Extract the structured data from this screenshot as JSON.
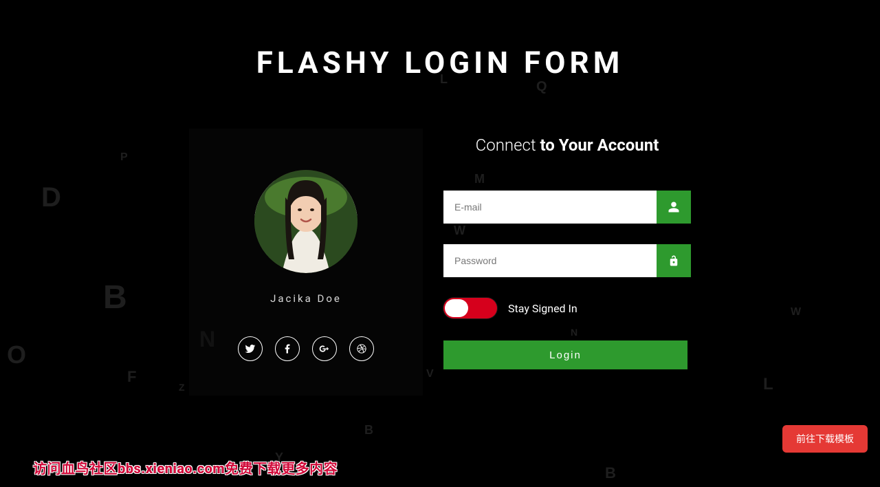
{
  "title": "FLASHY LOGIN FORM",
  "user_name": "Jacika Doe",
  "connect": {
    "light": "Connect ",
    "bold": "to Your Account"
  },
  "fields": {
    "email_placeholder": "E-mail",
    "password_placeholder": "Password"
  },
  "toggle_label": "Stay Signed In",
  "toggle_on": false,
  "login_label": "Login",
  "download_button": "前往下载模板",
  "watermark": "访问血鸟社区bbs.xieniao.com免费下载更多内容",
  "social_icons": [
    "twitter",
    "facebook",
    "google-plus",
    "dribbble"
  ],
  "colors": {
    "accent": "#2e9a2e",
    "danger": "#d6001c",
    "dl": "#e53935"
  }
}
